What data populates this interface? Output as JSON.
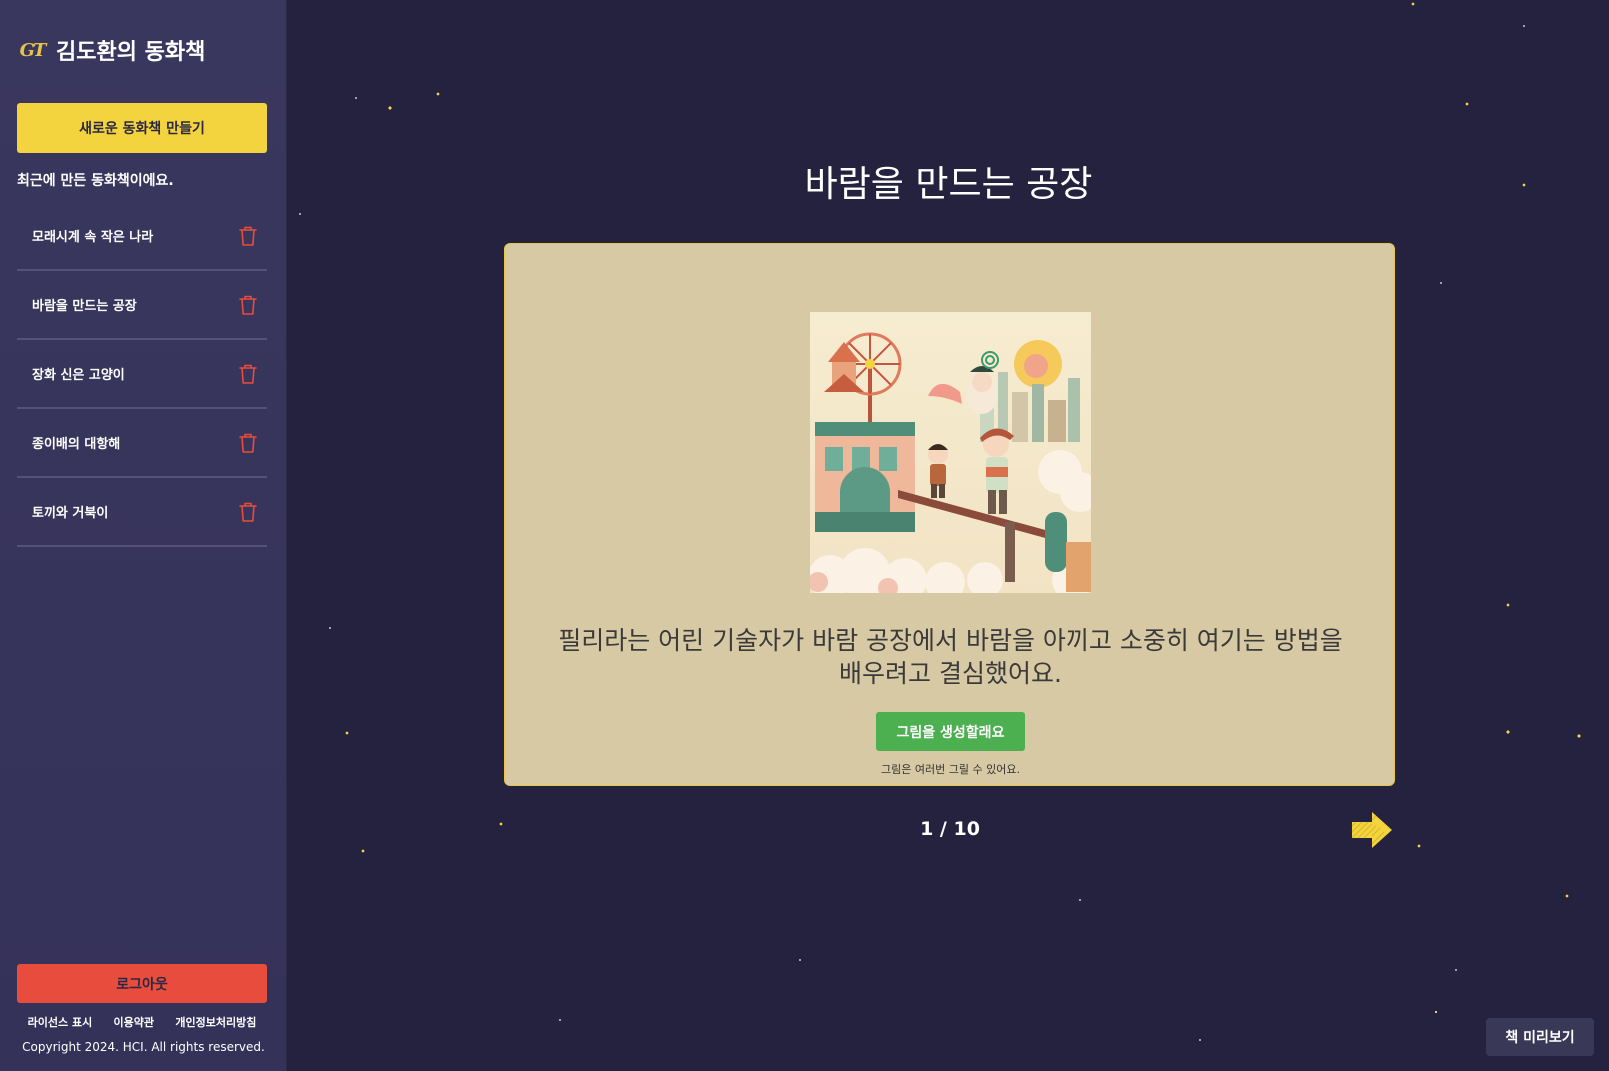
{
  "app": {
    "title": "김도환의 동화책",
    "logo_text": "GT"
  },
  "sidebar": {
    "new_book_label": "새로운 동화책 만들기",
    "recent_label": "최근에 만든 동화책이에요.",
    "books": [
      {
        "title": "모래시계 속 작은 나라"
      },
      {
        "title": "바람을 만드는 공장"
      },
      {
        "title": "장화 신은 고양이"
      },
      {
        "title": "종이배의 대항해"
      },
      {
        "title": "토끼와 거북이"
      }
    ],
    "logout_label": "로그아웃",
    "footer_links": [
      "라이선스 표시",
      "이용약관",
      "개인정보처리방침"
    ],
    "copyright": "Copyright 2024. HCI. All rights reserved."
  },
  "main": {
    "book_title": "바람을 만드는 공장",
    "story_text": "필리라는 어린 기술자가 바람 공장에서 바람을 아끼고 소중히 여기는 방법을 배우려고 결심했어요.",
    "generate_label": "그림을 생성할래요",
    "hint": "그림은 여러번 그릴 수 있어요.",
    "page_indicator": "1 / 10",
    "preview_label": "책 미리보기"
  },
  "colors": {
    "background": "#25223f",
    "sidebar": "#3a375e",
    "accent_yellow": "#f3d33e",
    "logout_red": "#e74c3c",
    "generate_green": "#4caf50",
    "card": "#d7c9a3",
    "trash_icon": "#e74c3c"
  },
  "icons": {
    "logo": "gt-logo-icon",
    "delete": "trash-icon",
    "next": "arrow-right-icon"
  }
}
